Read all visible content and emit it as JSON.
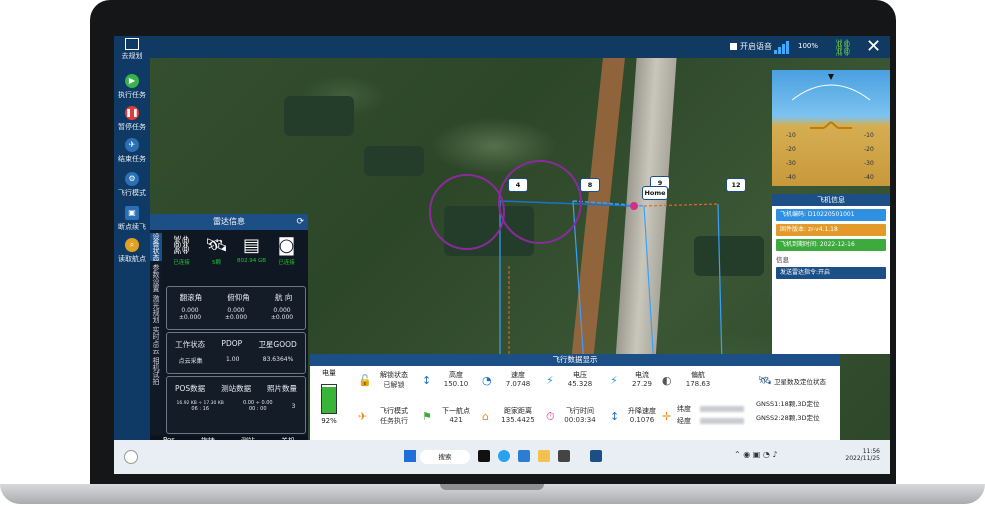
{
  "sidebar": {
    "logo_label": "去规划",
    "items": [
      {
        "label": "执行任务",
        "color": "#36b34a",
        "glyph": "▶"
      },
      {
        "label": "暂停任务",
        "color": "#e23b3b",
        "glyph": "⏸"
      },
      {
        "label": "结束任务",
        "color": "#2b6fb5",
        "glyph": "✈"
      },
      {
        "label": "飞行模式",
        "color": "#2b6fb5",
        "glyph": "⚙"
      },
      {
        "label": "断点续飞",
        "color": "#2b6fb5",
        "glyph": "💾"
      },
      {
        "label": "读取航点",
        "color": "#e0a020",
        "glyph": "🔍"
      }
    ]
  },
  "topbar": {
    "checkbox_label": "开启语音",
    "battery": "100%"
  },
  "radar": {
    "title": "雷达信息",
    "tabs": [
      "设备状态",
      "参数设置",
      "激光规划",
      "实时点云",
      "相机试拍"
    ],
    "icons": [
      {
        "glyph": "🔗",
        "label": "已连接"
      },
      {
        "glyph": "🛰",
        "label": "5颗"
      },
      {
        "glyph": "💾",
        "label": "802.94 GB"
      },
      {
        "glyph": "📷",
        "label": "已连接"
      }
    ],
    "angles": {
      "headers": [
        "翻滚角",
        "俯仰角",
        "航 向"
      ],
      "values": [
        [
          "0.000",
          "±0.000"
        ],
        [
          "0.000",
          "±0.000"
        ],
        [
          "0.000",
          "±0.000"
        ]
      ]
    },
    "status": {
      "headers": [
        "工作状态",
        "PDOP",
        "卫星GOOD"
      ],
      "values": [
        "点云采集",
        "1.00",
        "83.6364%"
      ]
    },
    "pos": {
      "headers": [
        "POS数据",
        "测站数据",
        "照片数量"
      ],
      "pos_line1": "16.92 KB ÷ 17.30 KB",
      "pos_line2": "06 : 16",
      "station_line1": "0.00 ÷ 0.00",
      "station_line2": "00 : 00",
      "photos": "3"
    },
    "bottom": [
      "Pos",
      "旋转",
      "测站",
      "关机"
    ]
  },
  "flight_info": {
    "title": "飞机信息",
    "rows": [
      {
        "text": "飞机编码: D10220501001",
        "color": "#2f8fe0"
      },
      {
        "text": "固件版本: zr-v4.1.18",
        "color": "#e39a2a"
      },
      {
        "text": "飞机到期时间: 2022-12-16",
        "color": "#3caa3c"
      }
    ],
    "info_label": "信息",
    "message": "发送雷达指令:开启",
    "message_color": "#1b4f86"
  },
  "attitude": {
    "ticks": [
      "-10",
      "-20",
      "-30",
      "-40"
    ]
  },
  "flight_data": {
    "title": "飞行数据显示",
    "battery_label": "电量",
    "battery_pct": "92%",
    "cells": [
      {
        "label": "解锁状态",
        "value": "已解锁",
        "icon": "🔓"
      },
      {
        "label": "高度",
        "value": "150.10",
        "icon": "↕"
      },
      {
        "label": "速度",
        "value": "7.0748",
        "icon": "◔"
      },
      {
        "label": "电压",
        "value": "45.328",
        "icon": "⚡"
      },
      {
        "label": "电流",
        "value": "27.29",
        "icon": "⚡"
      },
      {
        "label": "偏航",
        "value": "178.63",
        "icon": "◐"
      },
      {
        "label": "飞行模式",
        "value": "任务执行",
        "icon": "✈"
      },
      {
        "label": "下一航点",
        "value": "421",
        "icon": "⚑"
      },
      {
        "label": "距家距离",
        "value": "135.4425",
        "icon": "⌂"
      },
      {
        "label": "飞行时间",
        "value": "00:03:34",
        "icon": "⏱"
      },
      {
        "label": "升降速度",
        "value": "0.1076",
        "icon": "↕"
      },
      {
        "label": "纬度",
        "value": "",
        "icon": "✛"
      },
      {
        "label": "经度",
        "value": "",
        "icon": ""
      }
    ],
    "sat_title": "卫星数及定位状态",
    "gnss1": "GNSS1:18颗,3D定位",
    "gnss2": "GNSS2:28颗,3D定位"
  },
  "waypoints": [
    "4",
    "8",
    "9",
    "12"
  ],
  "home_label": "Home",
  "taskbar": {
    "search": "搜索",
    "time": "11:56",
    "date": "2022/11/25"
  }
}
